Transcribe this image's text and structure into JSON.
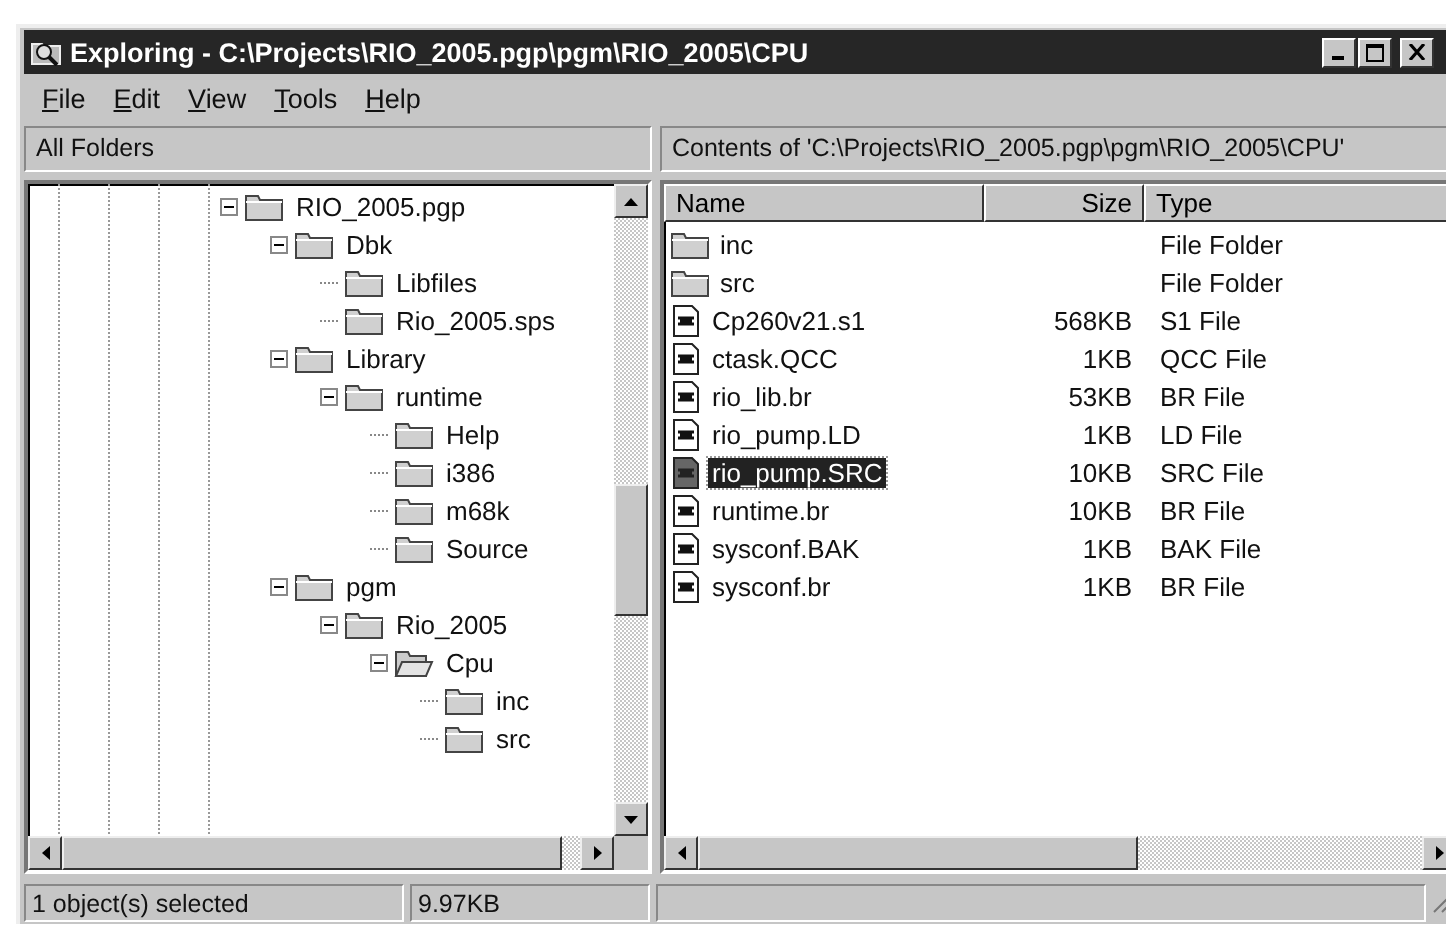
{
  "window": {
    "title": "Exploring - C:\\Projects\\RIO_2005.pgp\\pgm\\RIO_2005\\CPU"
  },
  "menu": [
    {
      "label": "File"
    },
    {
      "label": "Edit"
    },
    {
      "label": "View"
    },
    {
      "label": "Tools"
    },
    {
      "label": "Help"
    }
  ],
  "tree_header": "All Folders",
  "contents_header": "Contents of 'C:\\Projects\\RIO_2005.pgp\\pgm\\RIO_2005\\CPU'",
  "tree": [
    {
      "label": "RIO_2005.pgp",
      "expanded": true,
      "selected": false,
      "children": [
        {
          "label": "Dbk",
          "expanded": true,
          "selected": false,
          "children": [
            {
              "label": "Libfiles",
              "selected": false
            },
            {
              "label": "Rio_2005.sps",
              "selected": false
            }
          ]
        },
        {
          "label": "Library",
          "expanded": true,
          "selected": false,
          "children": [
            {
              "label": "runtime",
              "expanded": true,
              "selected": false,
              "children": [
                {
                  "label": "Help",
                  "selected": false
                },
                {
                  "label": "i386",
                  "selected": false
                },
                {
                  "label": "m68k",
                  "selected": false
                },
                {
                  "label": "Source",
                  "selected": false
                }
              ]
            }
          ]
        },
        {
          "label": "pgm",
          "expanded": true,
          "selected": false,
          "children": [
            {
              "label": "Rio_2005",
              "expanded": true,
              "selected": false,
              "children": [
                {
                  "label": "Cpu",
                  "expanded": true,
                  "selected": true,
                  "children": [
                    {
                      "label": "inc",
                      "selected": false
                    },
                    {
                      "label": "src",
                      "selected": false
                    }
                  ]
                }
              ]
            }
          ]
        }
      ]
    }
  ],
  "columns": [
    "Name",
    "Size",
    "Type"
  ],
  "files": [
    {
      "kind": "folder",
      "name": "inc",
      "type": "File Folder",
      "selected": false
    },
    {
      "kind": "folder",
      "name": "src",
      "type": "File Folder",
      "selected": false
    },
    {
      "kind": "file",
      "name": "Cp260v21.s1",
      "size": "568KB",
      "type": "S1 File",
      "selected": false
    },
    {
      "kind": "file",
      "name": "ctask.QCC",
      "size": "1KB",
      "type": "QCC File",
      "selected": false
    },
    {
      "kind": "file",
      "name": "rio_lib.br",
      "size": "53KB",
      "type": "BR File",
      "selected": false
    },
    {
      "kind": "file",
      "name": "rio_pump.LD",
      "size": "1KB",
      "type": "LD File",
      "selected": false
    },
    {
      "kind": "file",
      "name": "rio_pump.SRC",
      "size": "10KB",
      "type": "SRC File",
      "selected": true
    },
    {
      "kind": "file",
      "name": "runtime.br",
      "size": "10KB",
      "type": "BR File",
      "selected": false
    },
    {
      "kind": "file",
      "name": "sysconf.BAK",
      "size": "1KB",
      "type": "BAK File",
      "selected": false
    },
    {
      "kind": "file",
      "name": "sysconf.br",
      "size": "1KB",
      "type": "BR File",
      "selected": false
    }
  ],
  "status_bar": [
    "1 object(s) selected",
    "9.97KB"
  ]
}
